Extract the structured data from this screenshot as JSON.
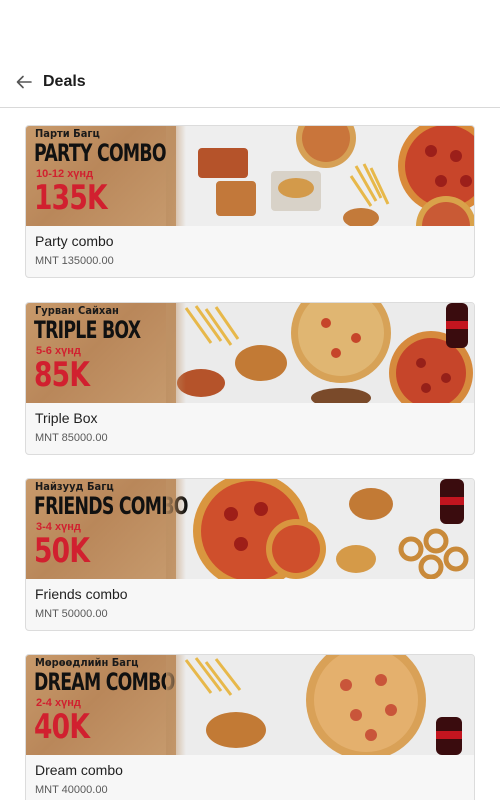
{
  "header": {
    "title": "Deals",
    "back_icon": "arrow-left-icon"
  },
  "deals": [
    {
      "banner_sub": "Парти Багц",
      "banner_name": "PARTY COMBO",
      "banner_people": "10-12 хүнд",
      "banner_price": "135K",
      "title": "Party combo",
      "price": "MNT 135000.00"
    },
    {
      "banner_sub": "Гурван Сайхан",
      "banner_name": "TRIPLE BOX",
      "banner_people": "5-6 хүнд",
      "banner_price": "85K",
      "title": "Triple Box",
      "price": "MNT 85000.00"
    },
    {
      "banner_sub": "Найзууд Багц",
      "banner_name": "FRIENDS COMBO",
      "banner_people": "3-4 хүнд",
      "banner_price": "50K",
      "title": "Friends combo",
      "price": "MNT 50000.00"
    },
    {
      "banner_sub": "Мөрөөдлийн Багц",
      "banner_name": "DREAM COMBO",
      "banner_people": "2-4 хүнд",
      "banner_price": "40K",
      "title": "Dream combo",
      "price": "MNT 40000.00"
    }
  ],
  "colors": {
    "accent_red": "#d1202f",
    "kraft": "#c89a6b",
    "card_bg": "#f7f7f7",
    "divider": "#d9d9d9"
  }
}
